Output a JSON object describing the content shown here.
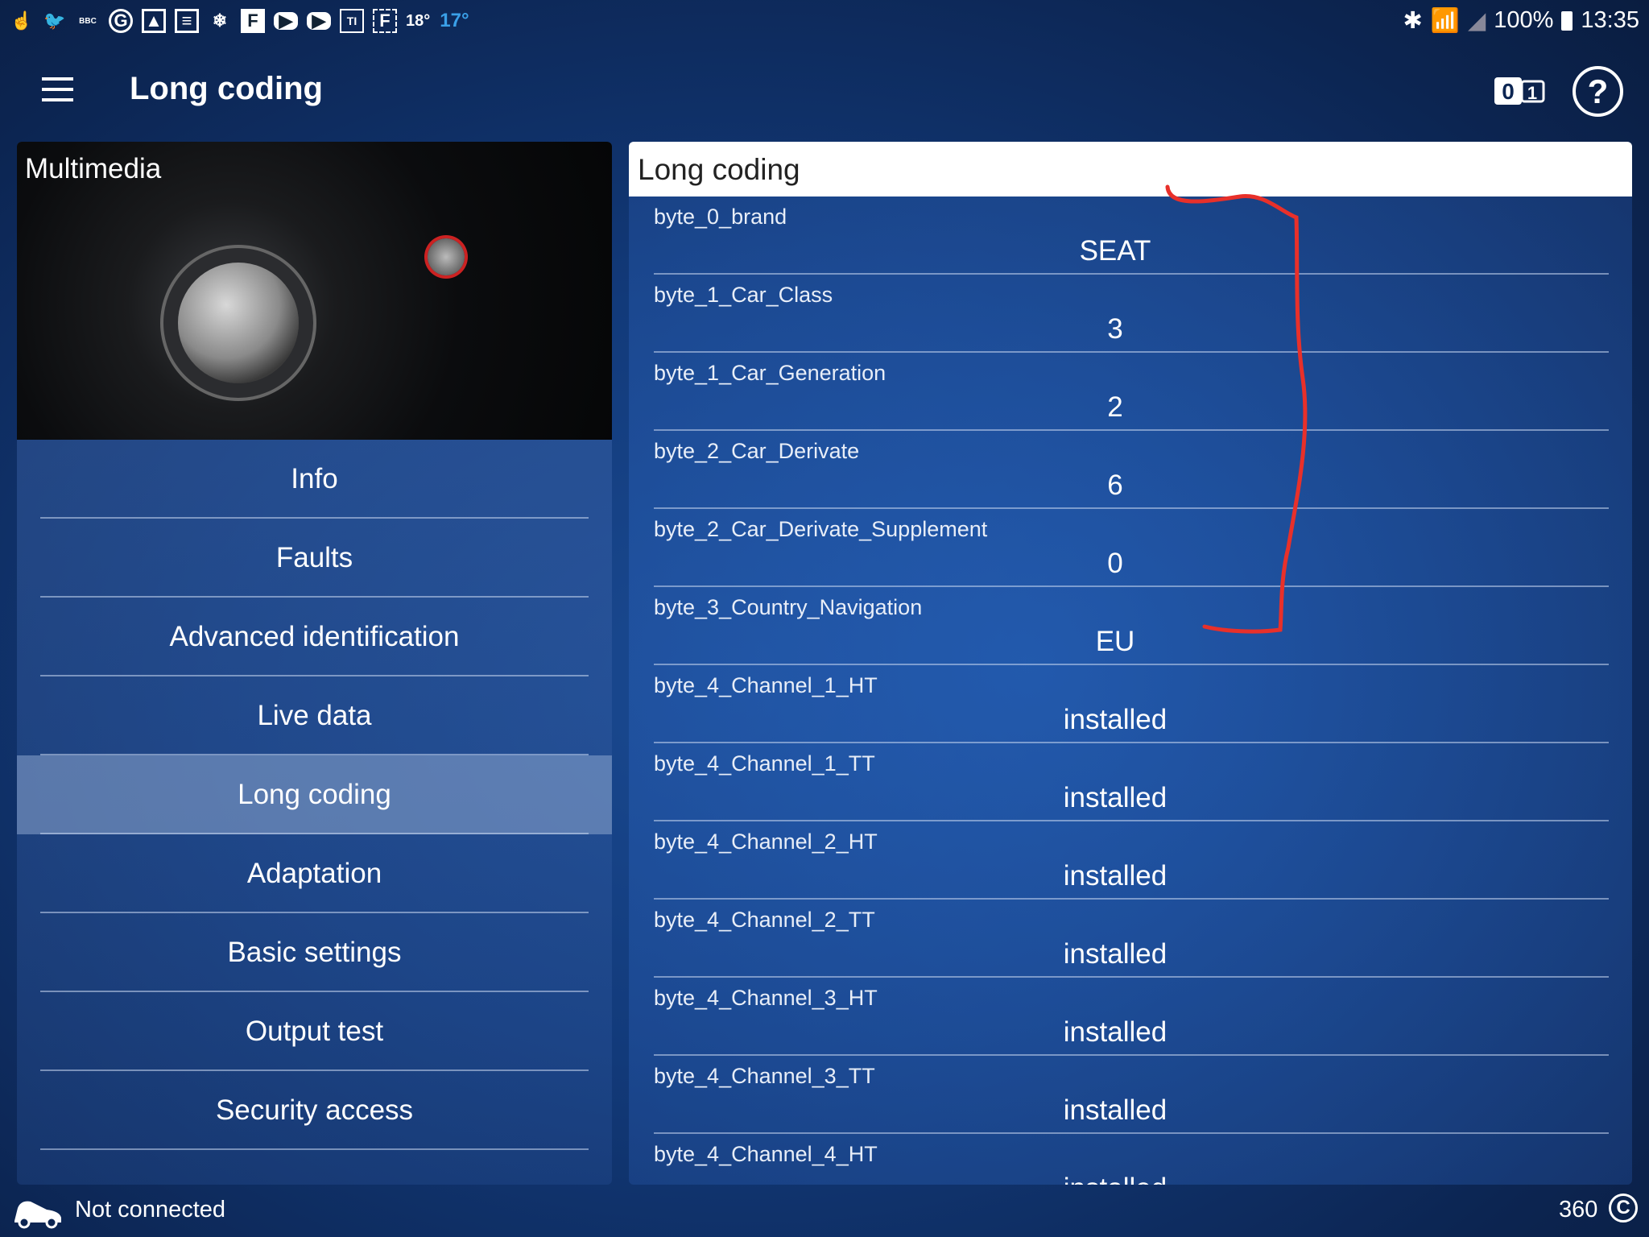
{
  "status_bar": {
    "icons": [
      "hand-icon",
      "twitter-icon",
      "bbc-news-icon",
      "guardian-icon",
      "gallery-icon",
      "news-icon",
      "weather-icon",
      "flipboard-icon",
      "youtube-icon",
      "youtube-icon",
      "translate-icon",
      "frame-icon"
    ],
    "temp1": "18°",
    "temp2": "17°",
    "battery": "100%",
    "time": "13:35"
  },
  "header": {
    "title": "Long coding"
  },
  "left": {
    "image_label": "Multimedia",
    "menu": [
      "Info",
      "Faults",
      "Advanced identification",
      "Live data",
      "Long coding",
      "Adaptation",
      "Basic settings",
      "Output test",
      "Security access"
    ],
    "selected": "Long coding"
  },
  "right": {
    "title": "Long coding",
    "rows": [
      {
        "k": "byte_0_brand",
        "v": "SEAT"
      },
      {
        "k": "byte_1_Car_Class",
        "v": "3"
      },
      {
        "k": "byte_1_Car_Generation",
        "v": "2"
      },
      {
        "k": "byte_2_Car_Derivate",
        "v": "6"
      },
      {
        "k": "byte_2_Car_Derivate_Supplement",
        "v": "0"
      },
      {
        "k": "byte_3_Country_Navigation",
        "v": "EU"
      },
      {
        "k": "byte_4_Channel_1_HT",
        "v": "installed"
      },
      {
        "k": "byte_4_Channel_1_TT",
        "v": "installed"
      },
      {
        "k": "byte_4_Channel_2_HT",
        "v": "installed"
      },
      {
        "k": "byte_4_Channel_2_TT",
        "v": "installed"
      },
      {
        "k": "byte_4_Channel_3_HT",
        "v": "installed"
      },
      {
        "k": "byte_4_Channel_3_TT",
        "v": "installed"
      },
      {
        "k": "byte_4_Channel_4_HT",
        "v": "installed"
      }
    ]
  },
  "footer": {
    "connection": "Not connected",
    "counter": "360"
  },
  "colors": {
    "annotation": "#e8302a",
    "selected_item": "#8ca5cd"
  }
}
